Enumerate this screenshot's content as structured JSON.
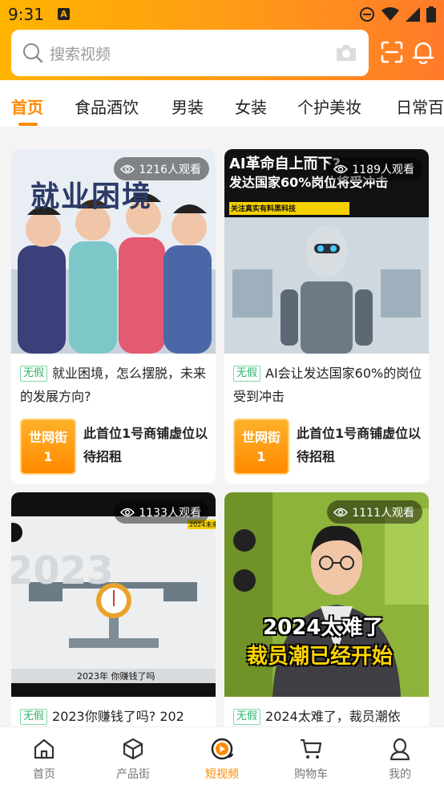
{
  "status_bar": {
    "time": "9:31",
    "notif_badge": "A"
  },
  "search": {
    "placeholder": "搜索视频"
  },
  "categories": [
    "首页",
    "食品酒饮",
    "男装",
    "女装",
    "个护美妆",
    "日常百"
  ],
  "colors": {
    "accent": "#ff8a00",
    "header_start": "#ffb400",
    "header_end": "#ff7a2a",
    "tag_green": "#2fb36b"
  },
  "cards": [
    {
      "views": "1216人观看",
      "tag": "无假",
      "title": "就业困境，怎么摆脱，未来的发展方向?",
      "shop_badge": "世网街\n1",
      "shop_badge_l1": "世网街",
      "shop_badge_l2": "1",
      "shop_text": "此首位1号商铺虚位以待招租",
      "thumb_text": "就业困境"
    },
    {
      "views": "1189人观看",
      "tag": "无假",
      "title": "AI会让发达国家60%的岗位受到冲击",
      "shop_badge_l1": "世网街",
      "shop_badge_l2": "1",
      "shop_text": "此首位1号商铺虚位以待招租",
      "thumb_text_1": "AI革命自上而下?",
      "thumb_text_2": "发达国家60%岗位将受冲击",
      "thumb_sub": "关注真实有料黑科技"
    },
    {
      "views": "1133人观看",
      "tag": "无假",
      "title": "2023你赚钱了吗? 202",
      "thumb_text": "2023",
      "thumb_caption": "2023年 你赚钱了吗",
      "thumb_corner": "2024未来"
    },
    {
      "views": "1111人观看",
      "tag": "无假",
      "title": "2024太难了，裁员潮依",
      "thumb_text_1": "2024太难了",
      "thumb_text_2": "裁员潮已经开始"
    }
  ],
  "bottom_nav": [
    {
      "label": "首页",
      "icon": "home-icon"
    },
    {
      "label": "产品街",
      "icon": "box-icon"
    },
    {
      "label": "短视频",
      "icon": "video-icon",
      "active": true
    },
    {
      "label": "购物车",
      "icon": "cart-icon"
    },
    {
      "label": "我的",
      "icon": "user-icon"
    }
  ]
}
